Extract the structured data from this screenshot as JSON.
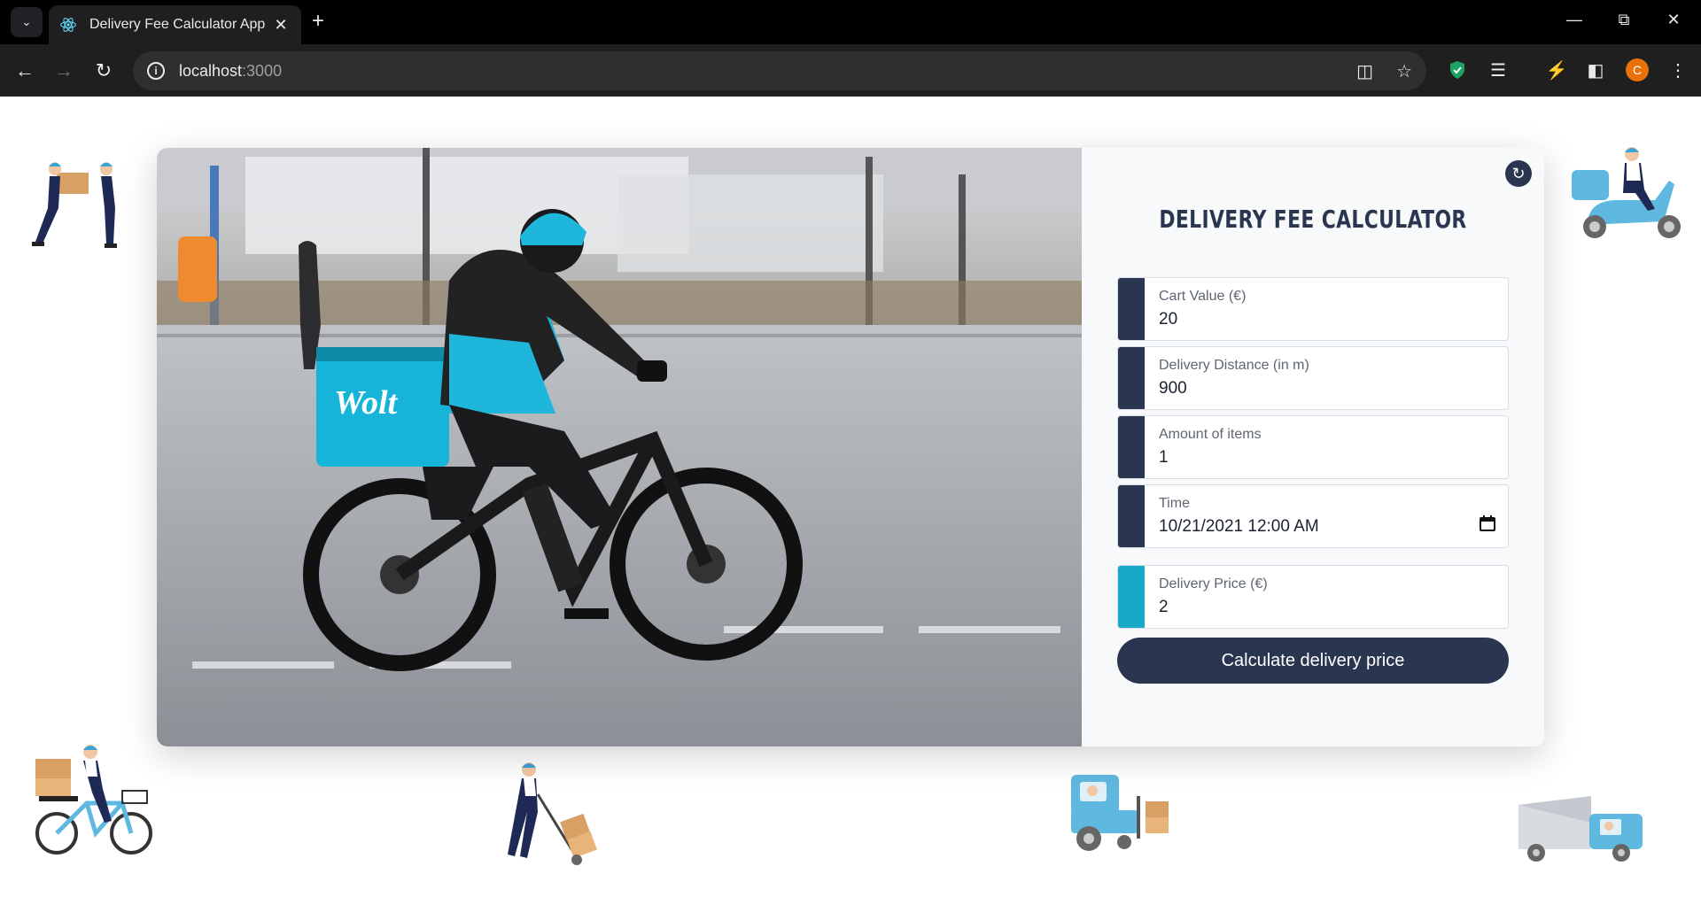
{
  "browser": {
    "tab_title": "Delivery Fee Calculator App",
    "url_host": "localhost",
    "url_port": ":3000",
    "profile_initial": "C"
  },
  "calculator": {
    "title": "DELIVERY FEE CALCULATOR",
    "fields": [
      {
        "label": "Cart Value (€)",
        "value": "20"
      },
      {
        "label": "Delivery Distance (in m)",
        "value": "900"
      },
      {
        "label": "Amount of items",
        "value": "1"
      },
      {
        "label": "Time",
        "value": "10/21/2021 12:00  AM"
      }
    ],
    "result": {
      "label": "Delivery Price (€)",
      "value": "2"
    },
    "submit_label": "Calculate delivery price"
  },
  "photo": {
    "bag_text": "Wolt"
  },
  "colors": {
    "navy": "#2a3550",
    "accent": "#17a9c7",
    "illustration_blue": "#5fb8e0"
  }
}
